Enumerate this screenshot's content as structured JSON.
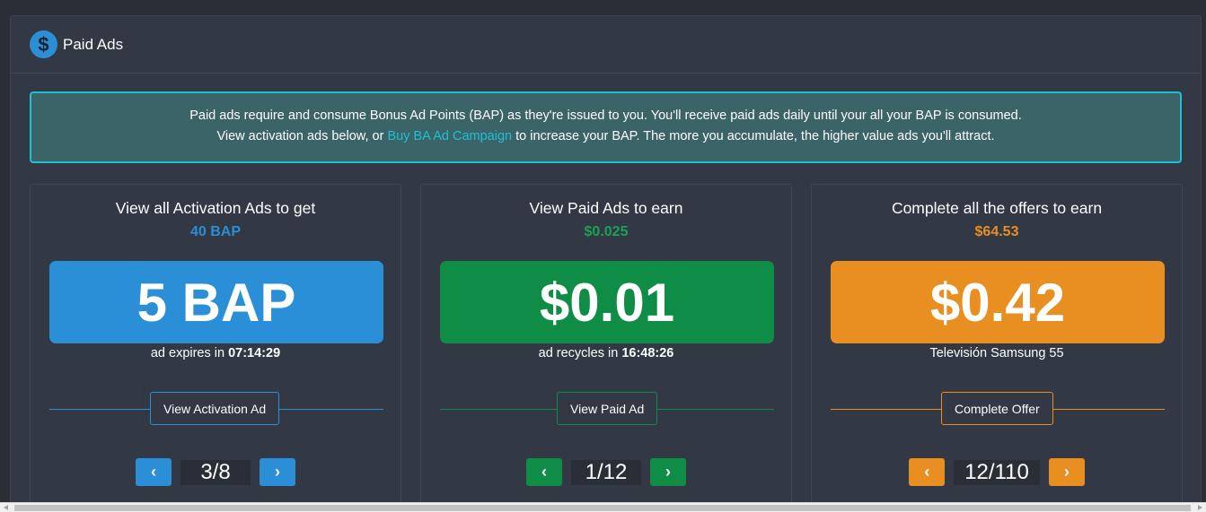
{
  "header": {
    "title": "Paid Ads",
    "icon": "dollar-icon"
  },
  "info": {
    "line1": "Paid ads require and consume Bonus Ad Points (BAP) as they're issued to you. You'll receive paid ads daily until your all your BAP is consumed.",
    "line2_pre": "View activation ads below, or ",
    "line2_link": "Buy BA Ad Campaign",
    "line2_post": " to increase your BAP. The more you accumulate, the higher value ads you'll attract."
  },
  "cards": [
    {
      "title": "View all Activation Ads to get",
      "subtitle": "40 BAP",
      "big_value": "5 BAP",
      "meta_label": "ad expires in ",
      "meta_value": "07:14:29",
      "button": "View Activation Ad",
      "counter": "3/8",
      "color": "#2a8fd6"
    },
    {
      "title": "View Paid Ads to earn",
      "subtitle": "$0.025",
      "big_value": "$0.01",
      "meta_label": "ad recycles in ",
      "meta_value": "16:48:26",
      "button": "View Paid Ad",
      "counter": "1/12",
      "color": "#0f8c46"
    },
    {
      "title": "Complete all the offers to earn",
      "subtitle": "$64.53",
      "big_value": "$0.42",
      "meta_label": "",
      "meta_value": "",
      "meta_text": "Televisión Samsung 55",
      "button": "Complete Offer",
      "counter": "12/110",
      "color": "#e98f22"
    }
  ],
  "icons": {
    "prev": "chevron-left-icon",
    "next": "chevron-right-icon"
  }
}
